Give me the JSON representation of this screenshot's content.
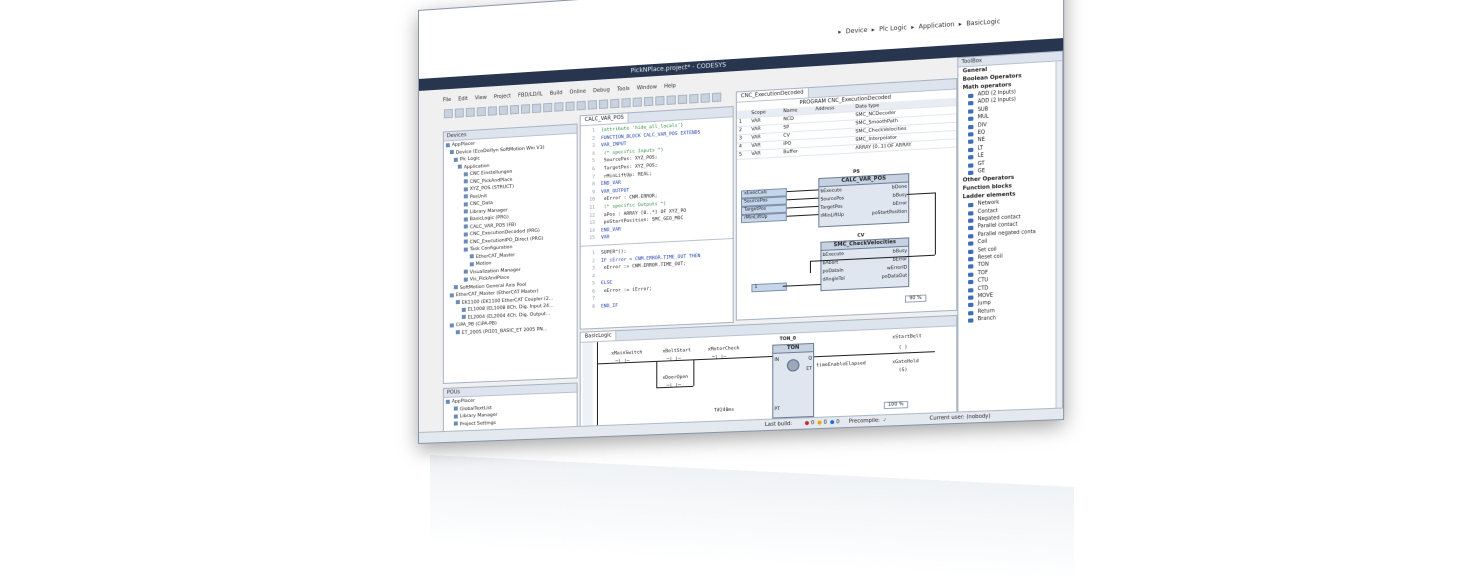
{
  "window": {
    "title": "PickNPlace.project* - CODESYS",
    "controls": [
      "minimize-icon",
      "maximize-icon",
      "close-icon"
    ]
  },
  "breadcrumb": [
    "Device",
    "Plc Logic",
    "Application",
    "BasicLogic"
  ],
  "menu": [
    "File",
    "Edit",
    "View",
    "Project",
    "FBD/LD/IL",
    "Build",
    "Online",
    "Debug",
    "Tools",
    "Window",
    "Help"
  ],
  "devices": {
    "header": "Devices",
    "items": [
      "AppPlacer",
      "Device (EcoDeHyn SoftMotion Win V3)",
      "Plc Logic",
      "Application",
      "CNC Einstellungen",
      "CNC_PickAndPlace",
      "XYZ_POS (STRUCT)",
      "PosUnit",
      "CNC_Data",
      "Library Manager",
      "BasicLogic (PRG)",
      "CALC_VAR_POS (FB)",
      "CNC_ExecutionDecoded (PRG)",
      "CNC_ExecutionIPO_Direct (PRG)",
      "Task Configuration",
      "EtherCAT_Master",
      "Motion",
      "Visualization Manager",
      "Vis_PickAndPlace",
      "SoftMotion General Axis Pool",
      "EtherCAT_Master (EtherCAT Master)",
      "EK1100 (EK1100 EtherCAT Coupler (2...",
      "EL1008 (EL1008 8Ch. Dig. Input 24...",
      "EL2004 (EL2004 4Ch. Dig. Output...",
      "CiPA_PB (CiPA-PB)",
      "ET_2005 (PI101_BASIC_ET 2005 PN..."
    ]
  },
  "pous": {
    "header": "POUs",
    "items": [
      "AppPlacer",
      "GlobalTextList",
      "Library Manager",
      "Project Settings"
    ]
  },
  "calc_editor": {
    "tab": "CALC_VAR_POS",
    "lines": [
      {
        "n": "1",
        "t": "{attribute 'hide_all_locals'}",
        "c": "cm"
      },
      {
        "n": "2",
        "t": "FUNCTION_BLOCK CALC_VAR_POS EXTENDS",
        "c": "kw"
      },
      {
        "n": "3",
        "t": "VAR_INPUT",
        "c": "kw"
      },
      {
        "n": "4",
        "t": "    (* specific Inputs *)",
        "c": "cm"
      },
      {
        "n": "5",
        "t": "    SourcePos: XYZ_POS;",
        "c": ""
      },
      {
        "n": "6",
        "t": "    TargetPos: XYZ_POS;",
        "c": ""
      },
      {
        "n": "7",
        "t": "    rMinLiftUp: REAL;",
        "c": ""
      },
      {
        "n": "8",
        "t": "END_VAR",
        "c": "kw"
      },
      {
        "n": "9",
        "t": "VAR_OUTPUT",
        "c": "kw"
      },
      {
        "n": "10",
        "t": "    eError : CNM.ERROR;",
        "c": ""
      },
      {
        "n": "11",
        "t": "    (* specific Outputs *)",
        "c": "cm"
      },
      {
        "n": "12",
        "t": "    aPos : ARRAY [0..*] OF XYZ_PO",
        "c": ""
      },
      {
        "n": "13",
        "t": "    poStartPosition: SMC_GEO_MOC",
        "c": ""
      },
      {
        "n": "14",
        "t": "END_VAR",
        "c": "kw"
      },
      {
        "n": "15",
        "t": "VAR",
        "c": "kw"
      }
    ],
    "body": [
      {
        "n": "1",
        "t": "SUPER^();",
        "c": ""
      },
      {
        "n": "2",
        "t": "IF iError = CNM.ERROR.TIME_OUT THEN",
        "c": "kw"
      },
      {
        "n": "3",
        "t": "    eError := CNM.ERROR.TIME_OUT;",
        "c": ""
      },
      {
        "n": "4",
        "t": "",
        "c": ""
      },
      {
        "n": "5",
        "t": "ELSE",
        "c": "kw"
      },
      {
        "n": "6",
        "t": "    eError := iError;",
        "c": ""
      },
      {
        "n": "7",
        "t": "",
        "c": ""
      },
      {
        "n": "8",
        "t": "END_IF",
        "c": "kw"
      }
    ]
  },
  "exec_editor": {
    "tab": "CNC_ExecutionDecoded",
    "header": "PROGRAM CNC_ExecutionDecoded",
    "columns": [
      "",
      "Scope",
      "Name",
      "Address",
      "Data type"
    ],
    "rows": [
      [
        "1",
        "VAR",
        "NCD",
        "",
        "SMC_NCDecoder"
      ],
      [
        "2",
        "VAR",
        "SP",
        "",
        "SMC_SmoothPath"
      ],
      [
        "3",
        "VAR",
        "CV",
        "",
        "SMC_CheckVelocities"
      ],
      [
        "4",
        "VAR",
        "IPO",
        "",
        "SMC_Interpolator"
      ],
      [
        "5",
        "VAR",
        "Buffer",
        "",
        "ARRAY [0..1] OF ARRAY"
      ]
    ],
    "fb1": {
      "inst": "PS",
      "type": "CALC_VAR_POS",
      "inputs": [
        "bExecute",
        "SourcePos",
        "TargetPos",
        "rMinLiftUp"
      ],
      "outputs": [
        "bDone",
        "bBusy",
        "bError",
        "poStartPosition"
      ]
    },
    "fb1_vars": [
      "xExecCalc",
      "SourcePos",
      "TargetPos",
      "rMinLiftUp"
    ],
    "fb2": {
      "inst": "CV",
      "type": "SMC_CheckVelocities",
      "inputs": [
        "bExecute",
        "bAbort",
        "poDataIn",
        "dAngleTol"
      ],
      "outputs": [
        "bBusy",
        "bError",
        "wErrorID",
        "poDataOut"
      ]
    },
    "fb2_const": "1",
    "zoom": "90 %"
  },
  "ld_editor": {
    "tab": "BasicLogic",
    "contacts": [
      "xMainSwitch",
      "xBeltStart",
      "xMotorCheck",
      "xDoorOpen"
    ],
    "timer": {
      "inst": "TON_0",
      "type": "TON",
      "in": "IN",
      "pt": "PT",
      "q": "Q",
      "et": "ET"
    },
    "pt_value": "T#240ms",
    "et_out": "timeEnableElapsed",
    "coils": [
      "xStartBelt",
      "xGateHold"
    ],
    "coil_sym": "(S)",
    "zoom": "100 %"
  },
  "toolbox": {
    "header": "ToolBox",
    "groups": [
      {
        "name": "General",
        "items": []
      },
      {
        "name": "Boolean Operators",
        "items": []
      },
      {
        "name": "Math operators",
        "items": [
          "ADD (2 Inputs)",
          "ADD (2 Inputs)",
          "SUB",
          "MUL",
          "DIV",
          "EQ",
          "NE",
          "LT",
          "LE",
          "GT",
          "GE"
        ]
      },
      {
        "name": "Other Operators",
        "items": []
      },
      {
        "name": "Function blocks",
        "items": []
      },
      {
        "name": "Ladder elements",
        "items": [
          "Network",
          "Contact",
          "Negated contact",
          "Parallel contact",
          "Parallel negated conta",
          "Coil",
          "Set coil",
          "Reset coil",
          "TON",
          "TOF",
          "CTU",
          "CTD",
          "MOVE",
          "Jump",
          "Return",
          "Branch"
        ]
      }
    ]
  },
  "status": {
    "last_build": "Last build:",
    "counts": [
      "0",
      "0",
      "0"
    ],
    "precompile": "Precompile:",
    "user": "Current user: (nobody)"
  },
  "colors": {
    "nav": "#27364e",
    "accent": "#3f6eb4",
    "fb_title": "#c6d2e2"
  }
}
